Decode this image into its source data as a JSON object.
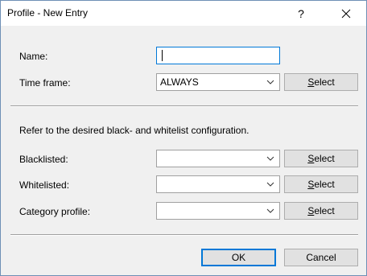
{
  "window": {
    "title": "Profile - New Entry",
    "help_label": "?",
    "close_label": "✕"
  },
  "form": {
    "name_label": "Name:",
    "name_value": "",
    "timeframe_label": "Time frame:",
    "timeframe_value": "ALWAYS",
    "info_text": "Refer to the desired black- and whitelist configuration.",
    "blacklisted_label": "Blacklisted:",
    "blacklisted_value": "",
    "whitelisted_label": "Whitelisted:",
    "whitelisted_value": "",
    "category_label": "Category profile:",
    "category_value": ""
  },
  "buttons": {
    "select_first": "S",
    "select_rest": "elect",
    "ok": "OK",
    "cancel": "Cancel"
  },
  "colors": {
    "focus_border": "#0078d7",
    "dialog_bg": "#f0f0f0",
    "button_bg": "#e1e1e1"
  }
}
